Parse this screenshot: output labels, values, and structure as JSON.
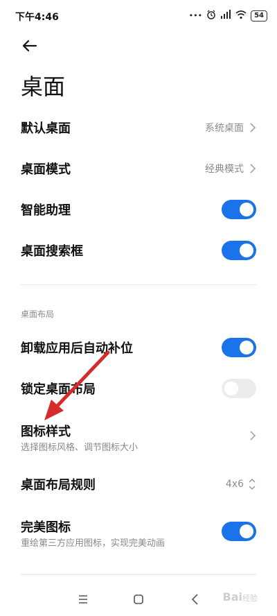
{
  "status_bar": {
    "time": "下午4:46",
    "battery": "54"
  },
  "page": {
    "title": "桌面"
  },
  "settings": [
    {
      "label": "默认桌面",
      "value": "系统桌面"
    },
    {
      "label": "桌面模式",
      "value": "经典模式"
    },
    {
      "label": "智能助理",
      "toggle": true
    },
    {
      "label": "桌面搜索框",
      "toggle": true
    }
  ],
  "layout_section": {
    "header": "桌面布局",
    "items": [
      {
        "label": "卸载应用后自动补位",
        "toggle": true
      },
      {
        "label": "锁定桌面布局",
        "toggle": false
      },
      {
        "label": "图标样式",
        "subtitle": "选择图标风格、调节图标大小"
      },
      {
        "label": "桌面布局规则",
        "value": "4x6"
      },
      {
        "label": "完美图标",
        "subtitle": "重绘第三方应用图标，实现完美动画",
        "toggle": true
      }
    ]
  },
  "colors": {
    "accent": "#1a73e8",
    "annotation": "#d62b2b"
  },
  "watermark": {
    "brand": "Bai",
    "suffix": "经验"
  }
}
